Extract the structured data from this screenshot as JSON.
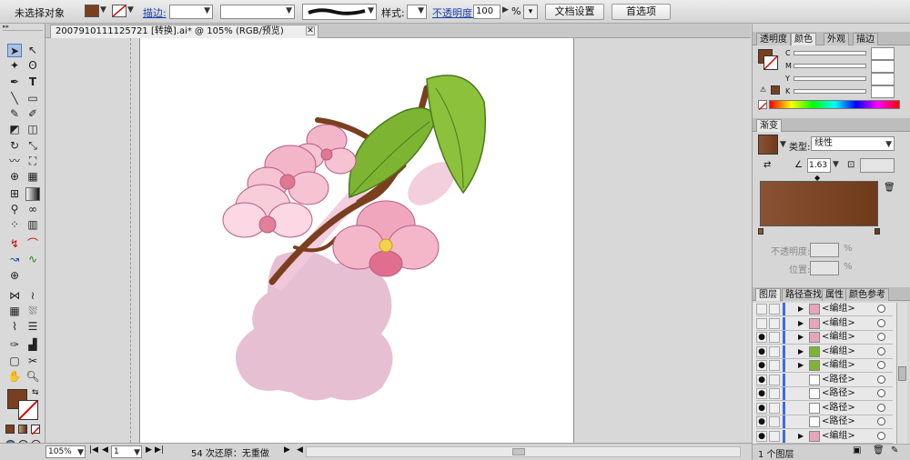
{
  "control_bar": {
    "selection_status": "未选择对象",
    "stroke_label": "描边:",
    "style_label": "样式:",
    "opacity_label": "不透明度:",
    "opacity_value": "100",
    "percent": "%",
    "doc_setup_button": "文档设置",
    "preferences_button": "首选项"
  },
  "document": {
    "tab_title": "2007910111125721 [转换].ai* @ 105% (RGB/预览)"
  },
  "status_bar": {
    "zoom": "105%",
    "page": "1",
    "info": "54 次还原：无重做"
  },
  "color_panel": {
    "tabs": [
      "透明度",
      "颜色",
      "外观",
      "描边"
    ],
    "active_tab": "颜色",
    "channels": [
      "C",
      "M",
      "Y",
      "K"
    ]
  },
  "gradient_panel": {
    "title": "渐变",
    "type_label": "类型:",
    "type_value": "线性",
    "angle_value": "1.63",
    "opacity_label": "不透明度:",
    "position_label": "位置:",
    "percent": "%"
  },
  "layers_panel": {
    "tabs": [
      "图层",
      "路径查找",
      "属性",
      "颜色参考"
    ],
    "active_tab": "图层",
    "rows": [
      {
        "name": "<编组>",
        "visible": false
      },
      {
        "name": "<编组>",
        "visible": false
      },
      {
        "name": "<编组>",
        "visible": true
      },
      {
        "name": "<编组>",
        "visible": true
      },
      {
        "name": "<编组>",
        "visible": true
      },
      {
        "name": "<路径>",
        "visible": true
      },
      {
        "name": "<路径>",
        "visible": true
      },
      {
        "name": "<路径>",
        "visible": true
      },
      {
        "name": "<路径>",
        "visible": true
      },
      {
        "name": "<编组>",
        "visible": true
      }
    ],
    "footer": "1 个图层"
  },
  "colors": {
    "fill": "#7a3f1f",
    "gradient_start": "#8a5234",
    "gradient_end": "#6f3a1a",
    "accent_blue": "#3d6bd8"
  }
}
